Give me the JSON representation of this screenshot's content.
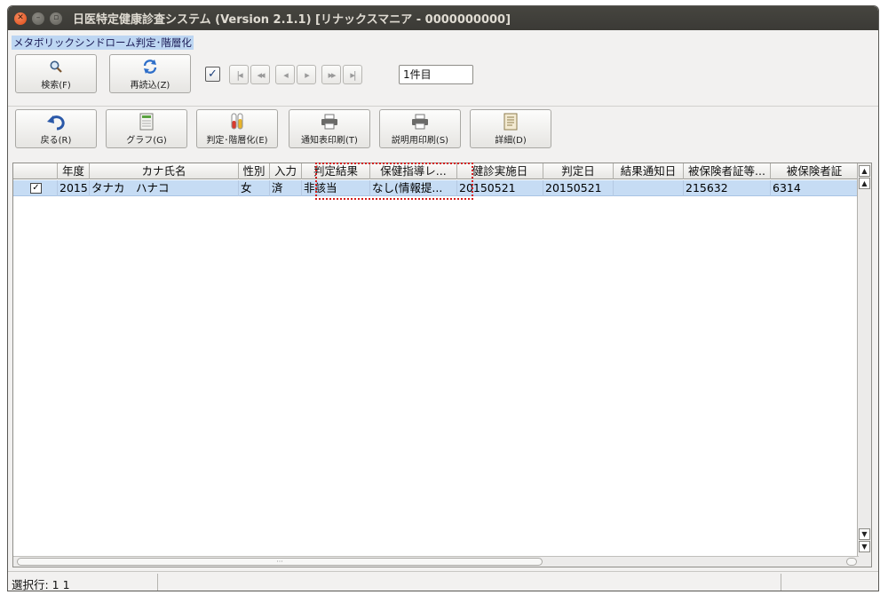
{
  "window": {
    "title": "日医特定健康診査システム (Version 2.1.1) [リナックスマニア - 0000000000]",
    "module_label": "メタボリックシンドローム判定･階層化"
  },
  "toolbar1": {
    "search_label": "検索(F)",
    "reload_label": "再読込(Z)",
    "select_all_checked": true,
    "nav_first": "|◂",
    "nav_prev_page": "◂◂",
    "nav_prev": "◂",
    "nav_next": "▸",
    "nav_next_page": "▸▸",
    "nav_last": "▸|",
    "record_count": "1件目"
  },
  "toolbar2": {
    "back_label": "戻る(R)",
    "graph_label": "グラフ(G)",
    "stratify_label": "判定･階層化(E)",
    "notice_print_label": "通知表印刷(T)",
    "explain_print_label": "説明用印刷(S)",
    "detail_label": "詳細(D)"
  },
  "table": {
    "columns": [
      "",
      "年度",
      "カナ氏名",
      "性別",
      "入力",
      "判定結果",
      "保健指導レ...",
      "健診実施日",
      "判定日",
      "結果通知日",
      "被保険者証等...",
      "被保険者証"
    ],
    "rows": [
      {
        "checked": true,
        "cells": [
          "2015",
          "タナカ　ハナコ",
          "女",
          "済",
          "非該当",
          "なし(情報提...",
          "20150521",
          "20150521",
          "",
          "215632",
          "6314"
        ]
      }
    ]
  },
  "status": {
    "selected_rows": "選択行: 1  1"
  },
  "colors": {
    "titlebar": "#3c3b37",
    "selection": "#c6dcf4",
    "highlight": "#d31d1d"
  }
}
